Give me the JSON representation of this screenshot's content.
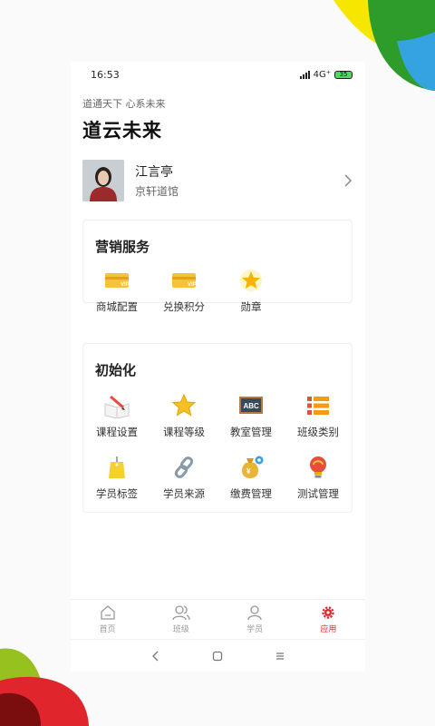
{
  "status_bar": {
    "time": "16:53",
    "network": "4G⁺",
    "battery": "35"
  },
  "header": {
    "slogan": "道通天下 心系未来",
    "title": "道云未来"
  },
  "profile": {
    "name": "江言亭",
    "school": "京轩道馆"
  },
  "marketing": {
    "title": "营销服务",
    "items": [
      {
        "label": "商城配置",
        "icon": "vip-card-icon"
      },
      {
        "label": "兑换积分",
        "icon": "vip-card-icon"
      },
      {
        "label": "勋章",
        "icon": "medal-star-icon"
      }
    ]
  },
  "init": {
    "title": "初始化",
    "items": [
      {
        "label": "课程设置",
        "icon": "open-book-pencil-icon"
      },
      {
        "label": "课程等级",
        "icon": "star-icon"
      },
      {
        "label": "教室管理",
        "icon": "abc-blackboard-icon"
      },
      {
        "label": "班级类别",
        "icon": "list-icon"
      },
      {
        "label": "学员标签",
        "icon": "tag-icon"
      },
      {
        "label": "学员来源",
        "icon": "chain-link-icon"
      },
      {
        "label": "缴费管理",
        "icon": "money-bag-icon"
      },
      {
        "label": "测试管理",
        "icon": "lightbulb-icon"
      }
    ]
  },
  "tabbar": {
    "tabs": [
      {
        "label": "首页",
        "icon": "home-icon"
      },
      {
        "label": "班级",
        "icon": "users-icon"
      },
      {
        "label": "学员",
        "icon": "user-icon"
      },
      {
        "label": "应用",
        "icon": "app-gear-icon"
      }
    ],
    "active": "应用"
  },
  "colors": {
    "accent": "#e0262c",
    "deco_yellow": "#f7e600",
    "deco_green": "#2e9c2a",
    "deco_blue": "#35a3e0",
    "deco_red": "#d4121b",
    "deco_maroon": "#7a0d0d"
  }
}
